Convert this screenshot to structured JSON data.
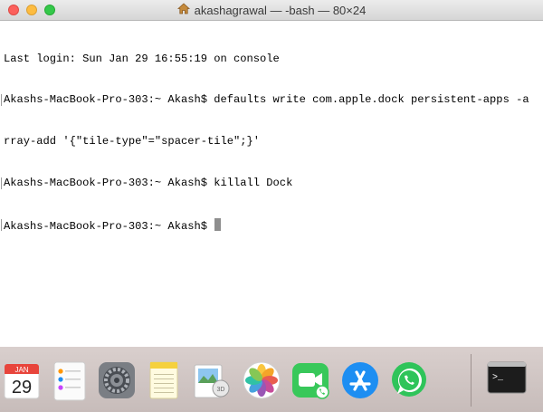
{
  "window": {
    "title": "akashagrawal — -bash — 80×24"
  },
  "terminal": {
    "lines": [
      "Last login: Sun Jan 29 16:55:19 on console",
      "Akashs-MacBook-Pro-303:~ Akash$ defaults write com.apple.dock persistent-apps -a",
      "rray-add '{\"tile-type\"=\"spacer-tile\";}'",
      "Akashs-MacBook-Pro-303:~ Akash$ killall Dock",
      "Akashs-MacBook-Pro-303:~ Akash$ "
    ]
  },
  "dock": {
    "calendar": {
      "month": "JAN",
      "day": "29"
    },
    "apps": [
      "calendar-icon",
      "reminders-icon",
      "system-preferences-icon",
      "notes-icon",
      "preview-icon",
      "photos-icon",
      "facetime-icon",
      "app-store-icon",
      "whatsapp-icon",
      "terminal-icon"
    ],
    "terminal_prompt": ">_"
  },
  "colors": {
    "close": "#fc605c",
    "minimize": "#fdbc40",
    "maximize": "#34c84a",
    "cursor": "#8e8e8e"
  }
}
